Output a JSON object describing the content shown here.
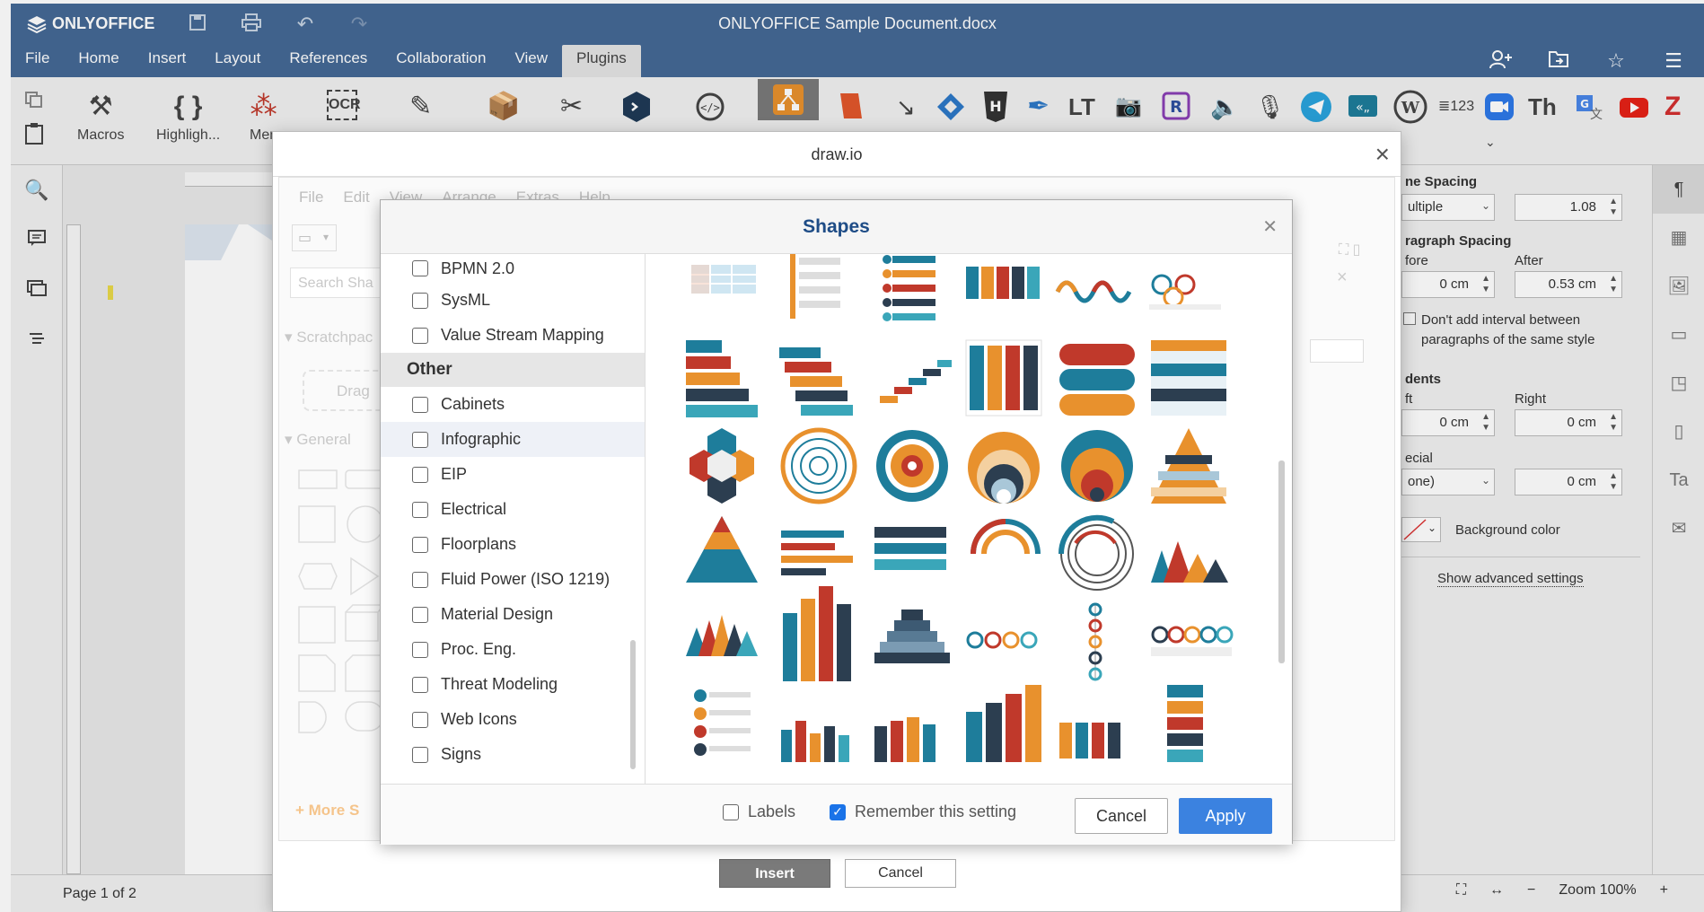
{
  "app": {
    "logo": "ONLYOFFICE",
    "document_title": "ONLYOFFICE Sample Document.docx"
  },
  "menu_tabs": [
    "File",
    "Home",
    "Insert",
    "Layout",
    "References",
    "Collaboration",
    "View",
    "Plugins"
  ],
  "active_tab": "Plugins",
  "toolbar": {
    "macros": "Macros",
    "highlight": "Highligh...",
    "mendeley": "Men",
    "ocr": "OCR"
  },
  "right_panel": {
    "line_spacing": "ne Spacing",
    "line_spacing_mode": "ultiple",
    "line_spacing_value": "1.08",
    "paragraph_spacing": "ragraph Spacing",
    "before": "fore",
    "after": "After",
    "before_value": "0 cm",
    "after_value": "0.53 cm",
    "dont_add_interval": "Don't add interval between paragraphs of the same style",
    "indents": "dents",
    "left": "ft",
    "right": "Right",
    "left_value": "0 cm",
    "right_value": "0 cm",
    "special": "ecial",
    "special_mode": "one)",
    "special_value": "0 cm",
    "background_color": "Background color",
    "show_advanced": "Show advanced settings"
  },
  "status": {
    "page": "Page 1 of 2",
    "zoom": "Zoom 100%"
  },
  "drawio": {
    "title": "draw.io",
    "menu": [
      "File",
      "Edit",
      "View",
      "Arrange",
      "Extras",
      "Help"
    ],
    "search_placeholder": "Search Sha",
    "scratchpad": "Scratchpac",
    "drag": "Drag",
    "general": "General",
    "more_shapes": "+ More S",
    "insert": "Insert",
    "cancel": "Cancel"
  },
  "shapes_dialog": {
    "title": "Shapes",
    "items_top": [
      "BPMN 2.0",
      "SysML",
      "Value Stream Mapping"
    ],
    "section": "Other",
    "items": [
      "Cabinets",
      "Infographic",
      "EIP",
      "Electrical",
      "Floorplans",
      "Fluid Power (ISO 1219)",
      "Material Design",
      "Proc. Eng.",
      "Threat Modeling",
      "Web Icons",
      "Signs"
    ],
    "highlighted": "Infographic",
    "labels": "Labels",
    "remember": "Remember this setting",
    "cancel": "Cancel",
    "apply": "Apply"
  },
  "colors": {
    "header_blue": "#446995",
    "apply_blue": "#3b82e0",
    "orange": "#e8912d",
    "teal": "#1e7d9b",
    "red": "#c0392b"
  }
}
